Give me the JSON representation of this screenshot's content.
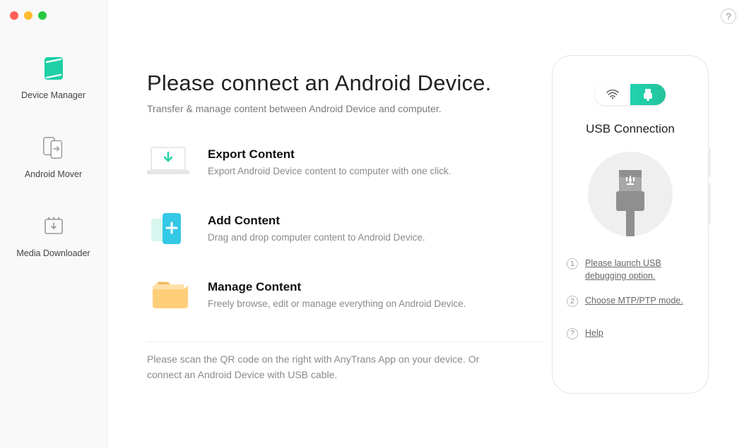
{
  "sidebar": {
    "items": [
      {
        "label": "Device Manager"
      },
      {
        "label": "Android Mover"
      },
      {
        "label": "Media Downloader"
      }
    ]
  },
  "help_icon_label": "?",
  "main": {
    "title": "Please connect an Android Device.",
    "subtitle": "Transfer & manage content between Android Device and computer.",
    "features": [
      {
        "title": "Export Content",
        "desc": "Export Android Device content to computer with one click."
      },
      {
        "title": "Add Content",
        "desc": "Drag and drop computer content to Android Device."
      },
      {
        "title": "Manage Content",
        "desc": "Freely browse, edit or manage everything on Android Device."
      }
    ],
    "footer_note": "Please scan the QR code on the right with AnyTrans App on your device. Or connect an Android Device with USB cable."
  },
  "device_panel": {
    "title": "USB Connection",
    "steps": [
      {
        "num": "1",
        "text": "Please launch USB debugging option."
      },
      {
        "num": "2",
        "text": "Choose MTP/PTP mode."
      }
    ],
    "help": {
      "num": "?",
      "text": "Help"
    }
  }
}
